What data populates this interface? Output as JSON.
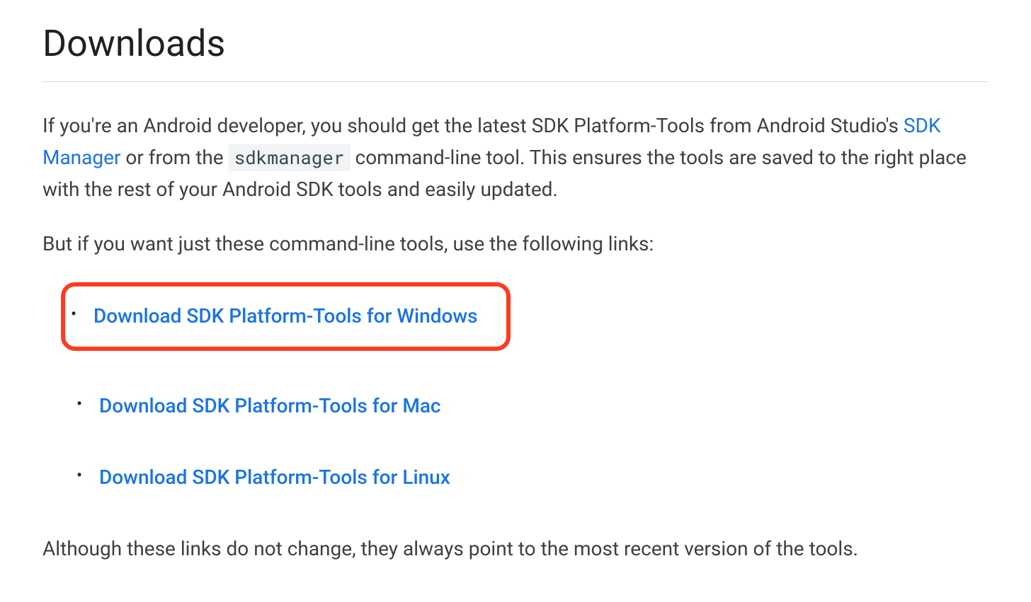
{
  "heading": "Downloads",
  "paragraph1_part1": "If you're an Android developer, you should get the latest SDK Platform-Tools from Android Studio's ",
  "paragraph1_link": "SDK Manager",
  "paragraph1_part2": " or from the ",
  "paragraph1_code": "sdkmanager",
  "paragraph1_part3": " command-line tool. This ensures the tools are saved to the right place with the rest of your Android SDK tools and easily updated.",
  "paragraph2": "But if you want just these command-line tools, use the following links:",
  "downloads": {
    "windows": "Download SDK Platform-Tools for Windows",
    "mac": "Download SDK Platform-Tools for Mac",
    "linux": "Download SDK Platform-Tools for Linux"
  },
  "paragraph3": "Although these links do not change, they always point to the most recent version of the tools."
}
